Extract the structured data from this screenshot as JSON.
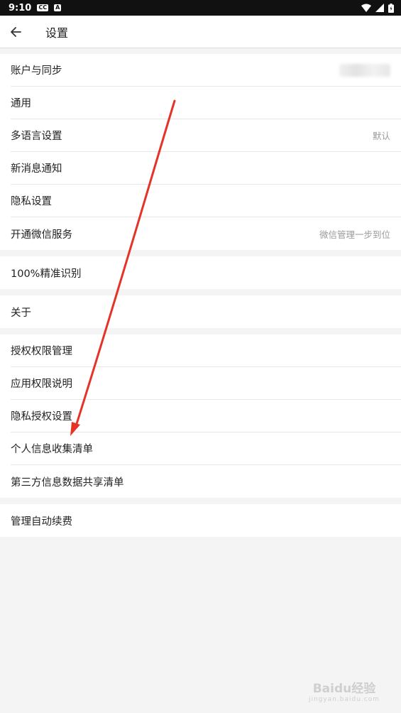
{
  "status_bar": {
    "time": "9:10",
    "badges": [
      "CC",
      "A"
    ],
    "icons": [
      "wifi-icon",
      "signal-icon",
      "battery-icon"
    ]
  },
  "app_bar": {
    "back_icon": "arrow-left-icon",
    "title": "设置"
  },
  "groups": [
    [
      {
        "key": "account",
        "label": "账户与同步",
        "value": "",
        "value_hidden": true
      },
      {
        "key": "general",
        "label": "通用",
        "value": ""
      },
      {
        "key": "language",
        "label": "多语言设置",
        "value": "默认"
      },
      {
        "key": "notifications",
        "label": "新消息通知",
        "value": ""
      },
      {
        "key": "privacy",
        "label": "隐私设置",
        "value": ""
      },
      {
        "key": "wechat",
        "label": "开通微信服务",
        "value": "微信管理一步到位"
      }
    ],
    [
      {
        "key": "accuracy",
        "label": "100%精准识别",
        "value": ""
      }
    ],
    [
      {
        "key": "about",
        "label": "关于",
        "value": ""
      }
    ],
    [
      {
        "key": "permission-manage",
        "label": "授权权限管理",
        "value": ""
      },
      {
        "key": "permission-info",
        "label": "应用权限说明",
        "value": ""
      },
      {
        "key": "privacy-auth",
        "label": "隐私授权设置",
        "value": ""
      },
      {
        "key": "personal-info",
        "label": "个人信息收集清单",
        "value": ""
      },
      {
        "key": "third-party",
        "label": "第三方信息数据共享清单",
        "value": ""
      }
    ],
    [
      {
        "key": "auto-renew",
        "label": "管理自动续费",
        "value": ""
      }
    ]
  ],
  "annotation": {
    "color": "#e53328"
  },
  "watermark": {
    "text": "Baidu经验",
    "sub": "jingyan.baidu.com"
  }
}
